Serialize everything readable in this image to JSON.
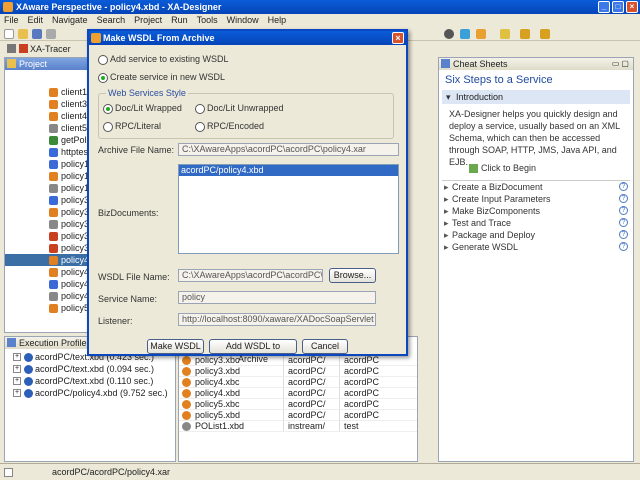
{
  "window": {
    "title": "XAware Perspective - policy4.xbd - XA-Designer"
  },
  "menu": [
    "File",
    "Edit",
    "Navigate",
    "Search",
    "Project",
    "Run",
    "Tools",
    "Window",
    "Help"
  ],
  "tabs": {
    "tracer": "XA-Tracer"
  },
  "navigator": {
    "title": "Project Navigator",
    "items": [
      "client1.x",
      "client3.x",
      "client4.x",
      "client5.x",
      "getPolic",
      "httptest",
      "policy1.",
      "policy1.",
      "policy1.",
      "policy3.",
      "policy3.",
      "policy3.",
      "policy3",
      "policy3",
      "policy4",
      "policy4.",
      "policy4.",
      "policy4",
      "policy5",
      "policy5"
    ]
  },
  "profile": {
    "title": "Execution Profile",
    "items": [
      "acordPC/text.xbd (0.423 sec.)",
      "acordPC/text.xbd (0.094 sec.)",
      "acordPC/text.xbd (0.110 sec.)",
      "acordPC/policy4.xbd (9.752 sec.)"
    ]
  },
  "bottom_table": {
    "rows": [
      [
        "policy3.xbc",
        "acordPC/",
        "acordPC"
      ],
      [
        "policy3.xbd",
        "acordPC/",
        "acordPC"
      ],
      [
        "policy4.xbc",
        "acordPC/",
        "acordPC"
      ],
      [
        "policy4.xbd",
        "acordPC/",
        "acordPC"
      ],
      [
        "policy5.xbc",
        "acordPC/",
        "acordPC"
      ],
      [
        "policy5.xbd",
        "acordPC/",
        "acordPC"
      ],
      [
        "POList1.xbd",
        "instream/",
        "test"
      ]
    ]
  },
  "cheat": {
    "tab": "Cheat Sheets",
    "title": "Six Steps to a Service",
    "intro": "Introduction",
    "intro_text": "XA-Designer helps you quickly design and deploy a service, usually based on an XML Schema, which can then be accessed through SOAP, HTTP, JMS, Java API, and EJB.",
    "click": "Click to Begin",
    "steps": [
      "Create a BizDocument",
      "Create Input Parameters",
      "Make BizComponents",
      "Test and Trace",
      "Package and Deploy",
      "Generate WSDL"
    ]
  },
  "status": {
    "path": "acordPC/acordPC/policy4.xar"
  },
  "dialog": {
    "title": "Make WSDL From Archive",
    "radio_add": "Add service to existing WSDL",
    "radio_create": "Create service in new WSDL",
    "style_group": "Web Services Style",
    "style_doc_wrapped": "Doc/Lit Wrapped",
    "style_doc_unwrapped": "Doc/Lit Unwrapped",
    "style_rpc_literal": "RPC/Literal",
    "style_rpc_encoded": "RPC/Encoded",
    "archive_label": "Archive File Name:",
    "archive_value": "C:\\XAwareApps\\acordPC\\acordPC\\policy4.xar",
    "bizdocs_label": "BizDocuments:",
    "bizdocs": [
      "acordPC/policy4.xbd"
    ],
    "wsdl_label": "WSDL File Name:",
    "wsdl_value": "C:\\XAwareApps\\acordPC\\acordPC\\p",
    "browse": "Browse...",
    "service_label": "Service Name:",
    "service_value": "policy",
    "listener_label": "Listener:",
    "listener_value": "http://localhost:8090/xaware/XADocSoapServlet",
    "make_btn": "Make WSDL",
    "add_btn": "Add WSDL to Archive",
    "cancel_btn": "Cancel"
  }
}
